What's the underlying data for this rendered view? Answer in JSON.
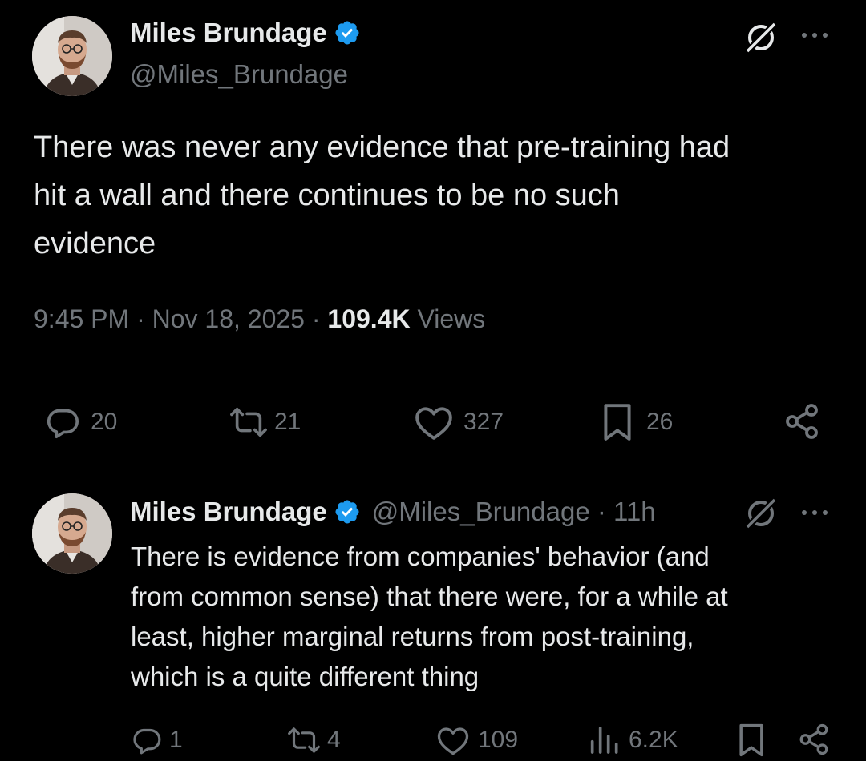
{
  "main_tweet": {
    "author_name": "Miles Brundage",
    "author_handle": "@Miles_Brundage",
    "text_lines": [
      "There was never any evidence that pre-training had",
      "hit a wall and there continues to be no such",
      "evidence"
    ],
    "time": "9:45 PM",
    "date": "Nov 18, 2025",
    "views_count": "109.4K",
    "views_label": "Views",
    "actions": {
      "replies": "20",
      "reposts": "21",
      "likes": "327",
      "bookmarks": "26"
    }
  },
  "reply_tweet": {
    "author_name": "Miles Brundage",
    "author_handle": "@Miles_Brundage",
    "age": "11h",
    "text_lines": [
      "There is evidence from companies' behavior (and",
      "from common sense) that there were, for a while at",
      "least, higher marginal returns from post-training,",
      "which is a quite different thing"
    ],
    "actions": {
      "replies": "1",
      "reposts": "4",
      "likes": "109",
      "views": "6.2K"
    }
  },
  "colors": {
    "background": "#000000",
    "text": "#e7e9ea",
    "muted": "#71767b",
    "verified": "#1d9bf0",
    "divider": "#2f3336"
  },
  "icons": [
    "verified-badge-icon",
    "grok-icon",
    "more-icon",
    "reply-icon",
    "repost-icon",
    "like-icon",
    "bookmark-icon",
    "share-icon",
    "views-icon"
  ]
}
